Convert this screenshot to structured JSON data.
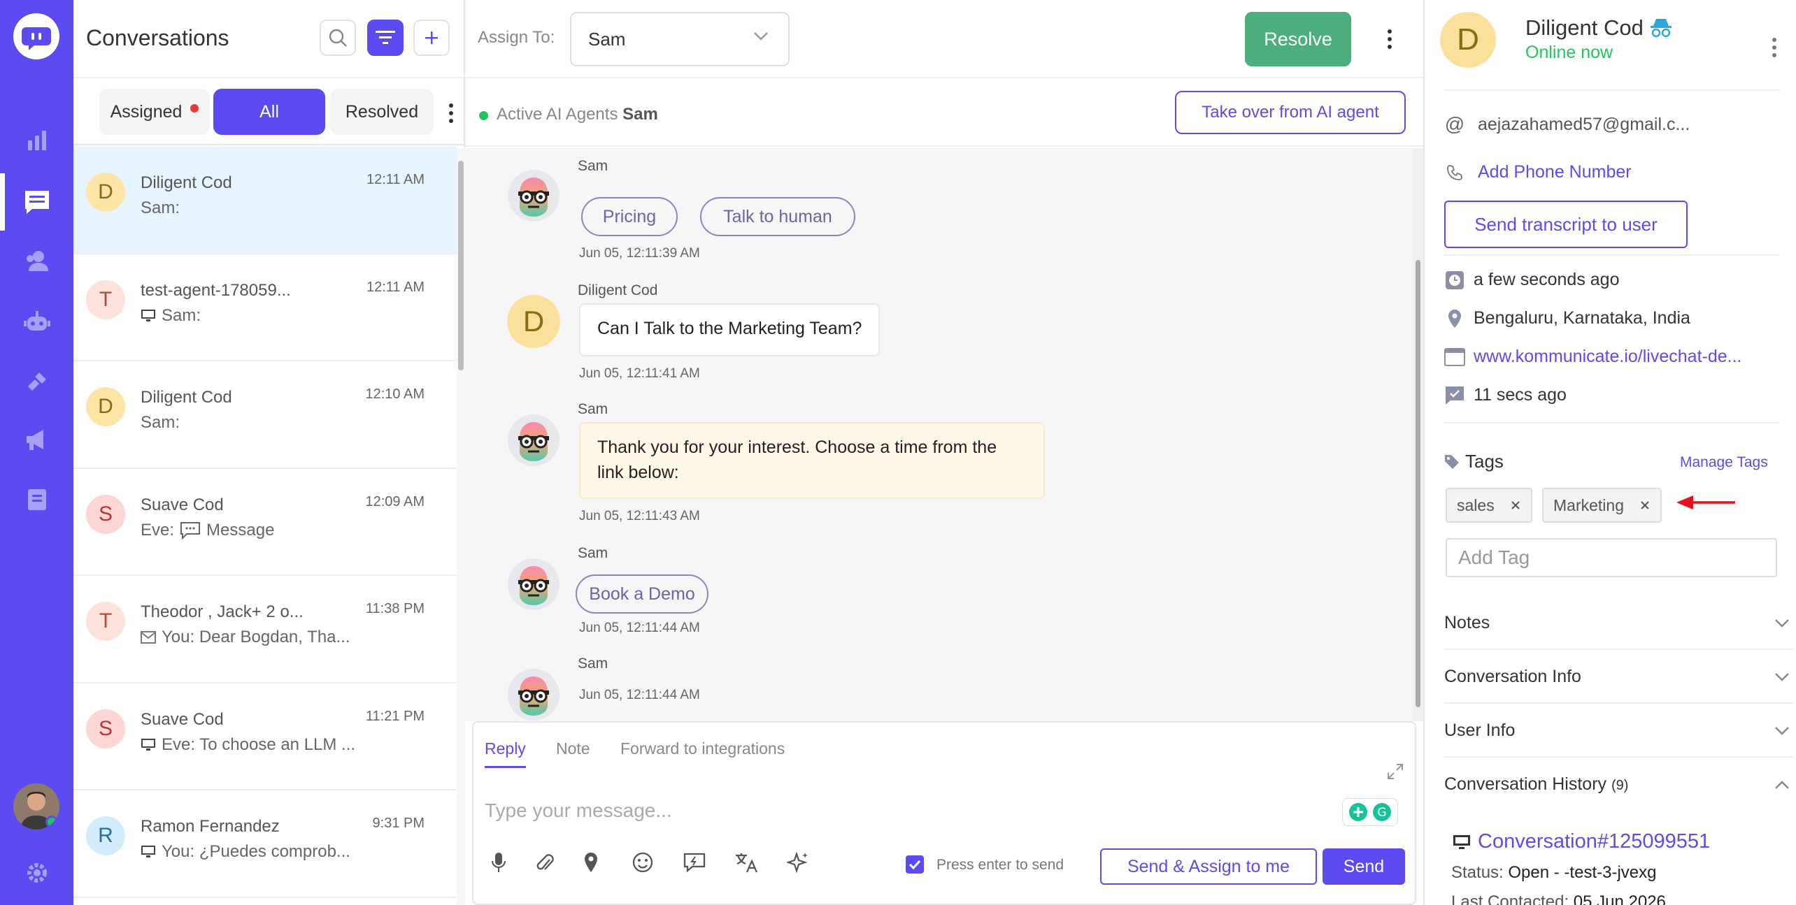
{
  "nav": {
    "items": [
      "reports",
      "conversations",
      "users",
      "bot",
      "integrations",
      "campaigns",
      "knowledge-base"
    ],
    "brand_color": "#5c4bf0"
  },
  "list": {
    "title": "Conversations",
    "tabs": {
      "assigned": "Assigned",
      "all": "All",
      "resolved": "Resolved"
    },
    "rows": [
      {
        "initial": "D",
        "name": "Diligent Cod",
        "time": "12:11 AM",
        "preview": "Sam:",
        "icon": "",
        "avbg": "#fde4a7",
        "avfg": "#8a6a14"
      },
      {
        "initial": "T",
        "name": "test-agent-178059...",
        "time": "12:11 AM",
        "preview": "Sam:",
        "icon": "monitor",
        "avbg": "#fde2dc",
        "avfg": "#b24a3a"
      },
      {
        "initial": "D",
        "name": "Diligent Cod",
        "time": "12:10 AM",
        "preview": "Sam:",
        "icon": "",
        "avbg": "#fde4a7",
        "avfg": "#8a6a14"
      },
      {
        "initial": "S",
        "name": "Suave Cod",
        "time": "12:09 AM",
        "preview": "Eve:  Message",
        "icon": "chat",
        "avbg": "#fcd5d5",
        "avfg": "#b23a3a"
      },
      {
        "initial": "T",
        "name": "Theodor , Jack+ 2 o...",
        "time": "11:38 PM",
        "preview": "You: Dear Bogdan, Tha...",
        "icon": "mail",
        "avbg": "#fde2dc",
        "avfg": "#b24a3a"
      },
      {
        "initial": "S",
        "name": "Suave Cod",
        "time": "11:21 PM",
        "preview": "Eve: To choose an LLM ...",
        "icon": "monitor",
        "avbg": "#fcd5d5",
        "avfg": "#b23a3a"
      },
      {
        "initial": "R",
        "name": "Ramon Fernandez",
        "time": "9:31 PM",
        "preview": "You: ¿Puedes comprob...",
        "icon": "monitor",
        "avbg": "#d2ecfb",
        "avfg": "#2a6f9a"
      }
    ]
  },
  "chat": {
    "assign_label": "Assign To:",
    "assignee": "Sam",
    "resolve": "Resolve",
    "ai_label": "Active AI Agents",
    "ai_name": "Sam",
    "takeover": "Take over from AI agent",
    "messages": {
      "m1_sender": "Sam",
      "m1_pill1": "Pricing",
      "m1_pill2": "Talk to human",
      "m1_time": "Jun 05, 12:11:39 AM",
      "m2_sender": "Diligent Cod",
      "m2_initial": "D",
      "m2_text": "Can I Talk to the Marketing Team?",
      "m2_time": "Jun 05, 12:11:41 AM",
      "m3_sender": "Sam",
      "m3_text": "Thank you for your interest. Choose a time from the link below:",
      "m3_time": "Jun 05, 12:11:43 AM",
      "m4_sender": "Sam",
      "m4_pill": "Book a Demo",
      "m4_time": "Jun 05, 12:11:44 AM",
      "m5_sender": "Sam",
      "m5_time": "Jun 05, 12:11:44 AM"
    },
    "composer": {
      "tab_reply": "Reply",
      "tab_note": "Note",
      "tab_forward": "Forward to integrations",
      "placeholder": "Type your message...",
      "enter_label": "Press enter to send",
      "send_assign": "Send & Assign to me",
      "send": "Send"
    }
  },
  "side": {
    "initial": "D",
    "name": "Diligent Cod",
    "status": "Online now",
    "email": "aejazahamed57@gmail.c...",
    "add_phone": "Add Phone Number",
    "transcript": "Send transcript to user",
    "last_seen": "a few seconds ago",
    "location": "Bengaluru, Karnataka, India",
    "page_url": "www.kommunicate.io/livechat-de...",
    "last_msg": "11 secs ago",
    "tags_title": "Tags",
    "manage_tags": "Manage Tags",
    "tags": [
      "sales",
      "Marketing"
    ],
    "add_tag": "Add Tag",
    "notes": "Notes",
    "conv_info": "Conversation Info",
    "user_info": "User Info",
    "conv_history": "Conversation History",
    "conv_history_count": "(9)",
    "conv_link": "Conversation#125099551",
    "status_label": "Status:",
    "status_value": "Open - -test-3-jvexg",
    "last_contacted_label": "Last Contacted:",
    "last_contacted_value": "05 Jun 2026"
  }
}
